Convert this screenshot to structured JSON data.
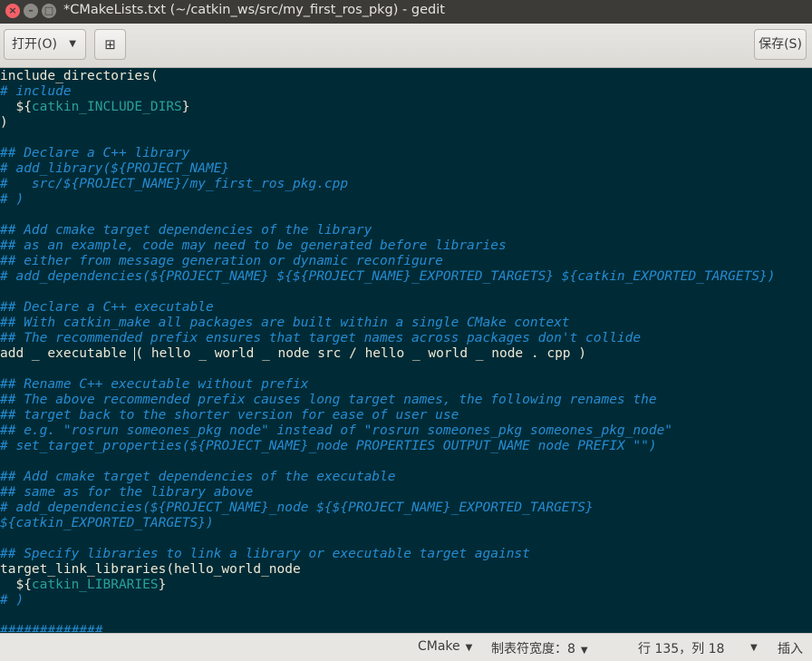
{
  "window": {
    "title": "*CMakeLists.txt (~/catkin_ws/src/my_first_ros_pkg) - gedit"
  },
  "toolbar": {
    "open_label": "打开(O)",
    "new_icon": "new-document-icon",
    "save_label": "保存(S)"
  },
  "editor": {
    "lines": [
      {
        "parts": [
          {
            "t": "include_directories(",
            "c": "n"
          }
        ]
      },
      {
        "parts": [
          {
            "t": "# include",
            "c": "c"
          }
        ]
      },
      {
        "parts": [
          {
            "t": "  ${",
            "c": "n"
          },
          {
            "t": "catkin_INCLUDE_DIRS",
            "c": "v"
          },
          {
            "t": "}",
            "c": "n"
          }
        ]
      },
      {
        "parts": [
          {
            "t": ")",
            "c": "n"
          }
        ]
      },
      {
        "parts": []
      },
      {
        "parts": [
          {
            "t": "## Declare a C++ library",
            "c": "c"
          }
        ]
      },
      {
        "parts": [
          {
            "t": "# add_library(${PROJECT_NAME}",
            "c": "c"
          }
        ]
      },
      {
        "parts": [
          {
            "t": "#   src/${PROJECT_NAME}/my_first_ros_pkg.cpp",
            "c": "c"
          }
        ]
      },
      {
        "parts": [
          {
            "t": "# )",
            "c": "c"
          }
        ]
      },
      {
        "parts": []
      },
      {
        "parts": [
          {
            "t": "## Add cmake target dependencies of the library",
            "c": "c"
          }
        ]
      },
      {
        "parts": [
          {
            "t": "## as an example, code may need to be generated before libraries",
            "c": "c"
          }
        ]
      },
      {
        "parts": [
          {
            "t": "## either from message generation or dynamic reconfigure",
            "c": "c"
          }
        ]
      },
      {
        "parts": [
          {
            "t": "# add_dependencies(${PROJECT_NAME} ${${PROJECT_NAME}_EXPORTED_TARGETS} ${catkin_EXPORTED_TARGETS})",
            "c": "c"
          }
        ]
      },
      {
        "parts": []
      },
      {
        "parts": [
          {
            "t": "## Declare a C++ executable",
            "c": "c"
          }
        ]
      },
      {
        "parts": [
          {
            "t": "## With catkin_make all packages are built within a single CMake context",
            "c": "c"
          }
        ]
      },
      {
        "parts": [
          {
            "t": "## The recommended prefix ensures that target names across packages don't collide",
            "c": "c"
          }
        ]
      },
      {
        "parts": [
          {
            "t": "add _ executable ",
            "c": "n"
          },
          {
            "t": "",
            "c": "caret"
          },
          {
            "t": "( hello _ world _ node src / hello _ world _ node . cpp )",
            "c": "n"
          }
        ]
      },
      {
        "parts": []
      },
      {
        "parts": [
          {
            "t": "## Rename C++ executable without prefix",
            "c": "c"
          }
        ]
      },
      {
        "parts": [
          {
            "t": "## The above recommended prefix causes long target names, the following renames the",
            "c": "c"
          }
        ]
      },
      {
        "parts": [
          {
            "t": "## target back to the shorter version for ease of user use",
            "c": "c"
          }
        ]
      },
      {
        "parts": [
          {
            "t": "## e.g. \"rosrun someones_pkg node\" instead of \"rosrun someones_pkg someones_pkg_node\"",
            "c": "c"
          }
        ]
      },
      {
        "parts": [
          {
            "t": "# set_target_properties(${PROJECT_NAME}_node PROPERTIES OUTPUT_NAME node PREFIX \"\")",
            "c": "c"
          }
        ]
      },
      {
        "parts": []
      },
      {
        "parts": [
          {
            "t": "## Add cmake target dependencies of the executable",
            "c": "c"
          }
        ]
      },
      {
        "parts": [
          {
            "t": "## same as for the library above",
            "c": "c"
          }
        ]
      },
      {
        "parts": [
          {
            "t": "# add_dependencies(${PROJECT_NAME}_node ${${PROJECT_NAME}_EXPORTED_TARGETS}",
            "c": "c"
          }
        ]
      },
      {
        "parts": [
          {
            "t": "${catkin_EXPORTED_TARGETS})",
            "c": "c"
          }
        ]
      },
      {
        "parts": []
      },
      {
        "parts": [
          {
            "t": "## Specify libraries to link a library or executable target against",
            "c": "c"
          }
        ]
      },
      {
        "parts": [
          {
            "t": "target_link_libraries(hello_world_node",
            "c": "n"
          }
        ]
      },
      {
        "parts": [
          {
            "t": "  ${",
            "c": "n"
          },
          {
            "t": "catkin_LIBRARIES",
            "c": "v"
          },
          {
            "t": "}",
            "c": "n"
          }
        ]
      },
      {
        "parts": [
          {
            "t": "# )",
            "c": "c"
          }
        ]
      },
      {
        "parts": []
      },
      {
        "parts": [
          {
            "t": "#############",
            "c": "c"
          }
        ]
      }
    ]
  },
  "statusbar": {
    "language": "CMake",
    "tab_width": "制表符宽度：8",
    "position": "行 135，列 18",
    "mode": "插入"
  }
}
